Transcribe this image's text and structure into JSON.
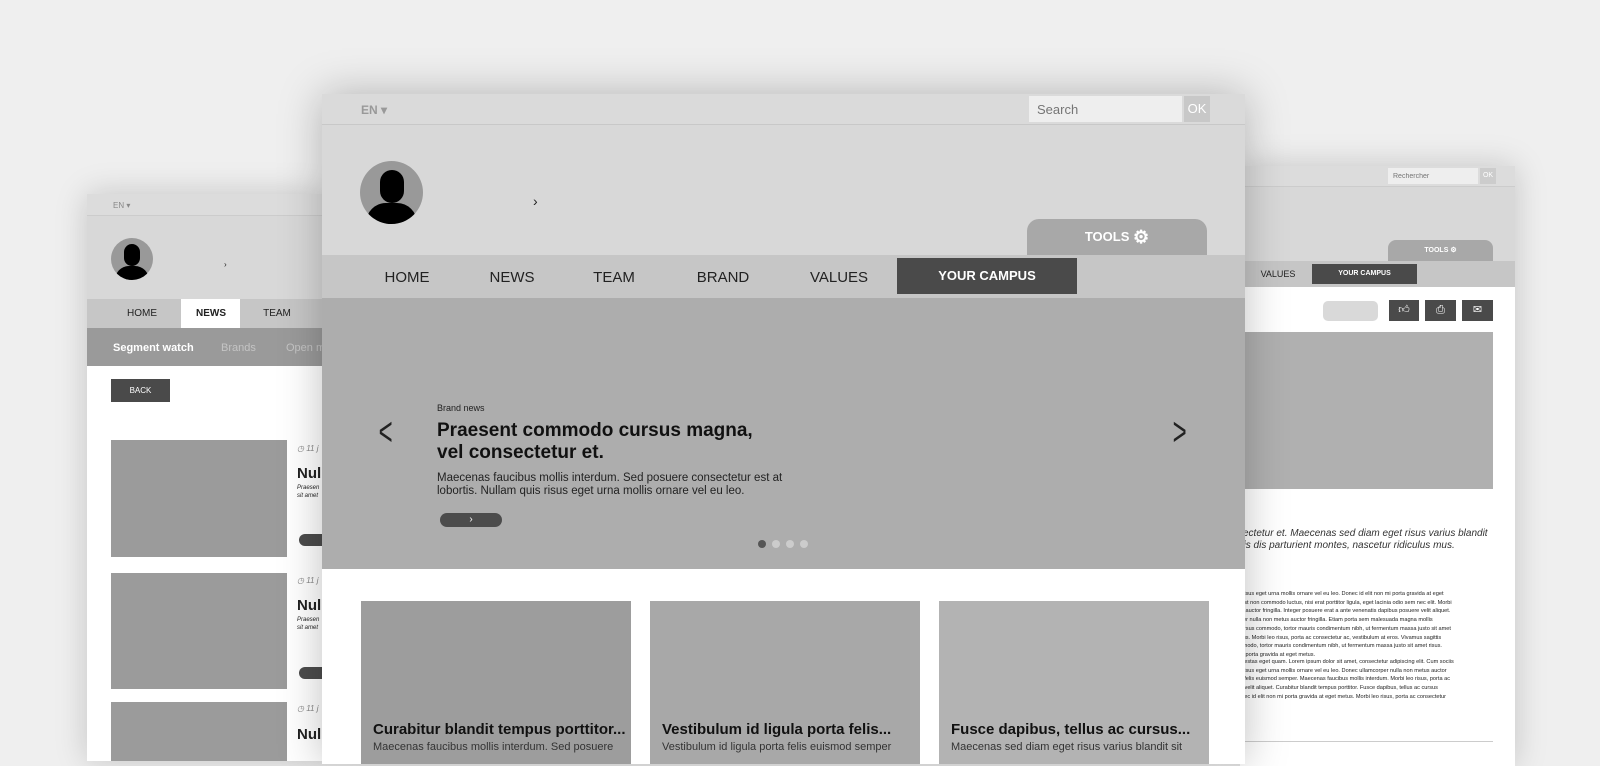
{
  "left": {
    "lang": "EN ▾",
    "nav": [
      "HOME",
      "NEWS",
      "TEAM"
    ],
    "active_nav": "NEWS",
    "subnav": [
      "Segment watch",
      "Brands",
      "Open m"
    ],
    "back": "BACK",
    "articles": [
      {
        "date": "11 j",
        "title": "Null",
        "excerpt": [
          "Praesen",
          "sit amet"
        ]
      },
      {
        "date": "11 j",
        "title": "Null",
        "excerpt": [
          "Praesen",
          "sit amet"
        ]
      },
      {
        "date": "11 j",
        "title": "Null"
      }
    ]
  },
  "main": {
    "lang": "EN ▾",
    "search_placeholder": "Search",
    "ok": "OK",
    "tools": "TOOLS",
    "nav": [
      "HOME",
      "NEWS",
      "TEAM",
      "BRAND",
      "VALUES"
    ],
    "active_nav": "YOUR CAMPUS",
    "hero": {
      "kicker": "Brand news",
      "title_1": "Praesent commodo cursus magna,",
      "title_2": "vel consectetur et.",
      "text_1": "Maecenas faucibus mollis interdum. Sed posuere consectetur est at",
      "text_2": "lobortis. Nullam quis risus eget urna mollis ornare vel eu leo.",
      "slides": 4,
      "active_slide": 1
    },
    "cards": [
      {
        "title": "Curabitur blandit tempus porttitor...",
        "text": "Maecenas faucibus mollis interdum. Sed posuere"
      },
      {
        "title": "Vestibulum id ligula porta felis...",
        "text": "Vestibulum id ligula porta felis euismod semper"
      },
      {
        "title": "Fusce dapibus, tellus ac cursus...",
        "text": "Maecenas sed diam eget risus varius blandit sit"
      }
    ]
  },
  "right": {
    "search_placeholder": "Rechercher",
    "ok": "OK",
    "tools": "TOOLS",
    "nav": [
      "VALUES"
    ],
    "active_nav": "YOUR CAMPUS",
    "lead_1": "sectetur et. Maecenas sed diam eget risus varius blandit",
    "lead_2": "nis dis parturient montes, nascetur ridiculus mus.",
    "para1": [
      "s risus eget urna mollis ornare vel eu leo. Donec id elit non mi porta gravida at eget",
      ", est non commodo luctus, nisi erat porttitor ligula, eget lacinia odio sem nec elit. Morbi",
      "us auctor fringilla. Integer posuere erat a ante venenatis dapibus posuere velit aliquet.",
      "rper nulla non metus auctor fringilla. Etiam porta sem malesuada magna mollis",
      "cursus commodo, tortor mauris condimentum nibh, ut fermentum massa justo sit amet",
      " mus. Morbi leo risus, porta ac consectetur ac, vestibulum at eros. Vivamus sagittis",
      "mmodo, tortor mauris condimentum nibh, ut fermentum massa justo sit amet risus.",
      "mi porta gravida at eget metus."
    ],
    "para2": [
      "egestas eget quam. Lorem ipsum dolor sit amet, consectetur adipiscing elit. Cum sociis",
      "s risus eget urna mollis ornare vel eu leo. Donec ullamcorper nulla non metus auctor",
      "ta felis euismod semper. Maecenas faucibus mollis interdum. Morbi leo risus, porta ac",
      "re velit aliquet. Curabitur blandit tempus porttitor. Fusce dapibus, tellus ac cursus",
      "onec id elit non mi porta gravida at eget metus. Morbi leo risus, porta ac consectetur",
      "."
    ]
  },
  "colors": {
    "background": "#efefef",
    "dark": "#4a4a4a",
    "hero": "#adadad"
  }
}
